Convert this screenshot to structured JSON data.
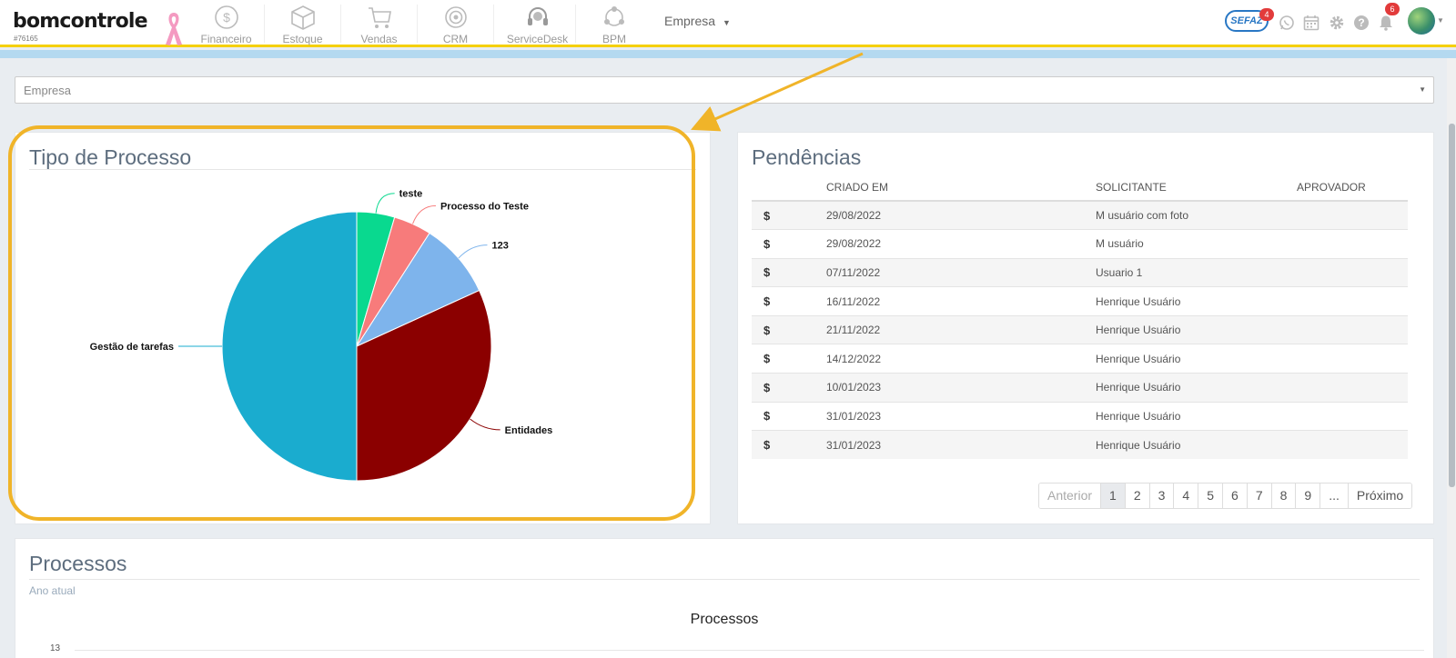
{
  "brand": {
    "logo_text": "bomcontrole",
    "account_id": "#76165"
  },
  "nav": {
    "modules": [
      {
        "label": "Financeiro",
        "icon": "dollar-coin-icon"
      },
      {
        "label": "Estoque",
        "icon": "box-icon"
      },
      {
        "label": "Vendas",
        "icon": "cart-icon"
      },
      {
        "label": "CRM",
        "icon": "target-icon"
      },
      {
        "label": "ServiceDesk",
        "icon": "headset-icon"
      },
      {
        "label": "BPM",
        "icon": "network-icon"
      }
    ],
    "company_menu": "Empresa",
    "sefaz_label": "SEFAZ",
    "sefaz_badge": "4",
    "notifications_badge": "6"
  },
  "filter": {
    "company_select_value": "Empresa"
  },
  "tipo_processo": {
    "title": "Tipo de Processo",
    "chart_data": {
      "type": "pie",
      "title": "Tipo de Processo",
      "slices": [
        {
          "label": "teste",
          "value": 1,
          "color": "#09d98f"
        },
        {
          "label": "Processo do Teste",
          "value": 1,
          "color": "#f77b7b"
        },
        {
          "label": "123",
          "value": 2,
          "color": "#7eb4ec"
        },
        {
          "label": "Entidades",
          "value": 7,
          "color": "#8b0000"
        },
        {
          "label": "Gestão de tarefas",
          "value": 11,
          "color": "#1aaccf"
        }
      ]
    }
  },
  "pendencias": {
    "title": "Pendências",
    "columns": [
      "",
      "CRIADO EM",
      "SOLICITANTE",
      "APROVADOR"
    ],
    "rows": [
      {
        "icon": "$",
        "created": "29/08/2022",
        "requester": "M usuário com foto",
        "approver": ""
      },
      {
        "icon": "$",
        "created": "29/08/2022",
        "requester": "M usuário",
        "approver": ""
      },
      {
        "icon": "$",
        "created": "07/11/2022",
        "requester": "Usuario 1",
        "approver": ""
      },
      {
        "icon": "$",
        "created": "16/11/2022",
        "requester": "Henrique Usuário",
        "approver": ""
      },
      {
        "icon": "$",
        "created": "21/11/2022",
        "requester": "Henrique Usuário",
        "approver": ""
      },
      {
        "icon": "$",
        "created": "14/12/2022",
        "requester": "Henrique Usuário",
        "approver": ""
      },
      {
        "icon": "$",
        "created": "10/01/2023",
        "requester": "Henrique Usuário",
        "approver": ""
      },
      {
        "icon": "$",
        "created": "31/01/2023",
        "requester": "Henrique Usuário",
        "approver": ""
      },
      {
        "icon": "$",
        "created": "31/01/2023",
        "requester": "Henrique Usuário",
        "approver": ""
      }
    ],
    "pagination": {
      "previous": "Anterior",
      "pages": [
        "1",
        "2",
        "3",
        "4",
        "5",
        "6",
        "7",
        "8",
        "9",
        "..."
      ],
      "next": "Próximo",
      "current": "1"
    }
  },
  "processos": {
    "title": "Processos",
    "subtitle": "Ano atual",
    "chart_title": "Processos",
    "y_top_tick": "13"
  },
  "colors": {
    "annotation_highlight": "#f0b429",
    "navbar_accent": "#f5d000"
  }
}
